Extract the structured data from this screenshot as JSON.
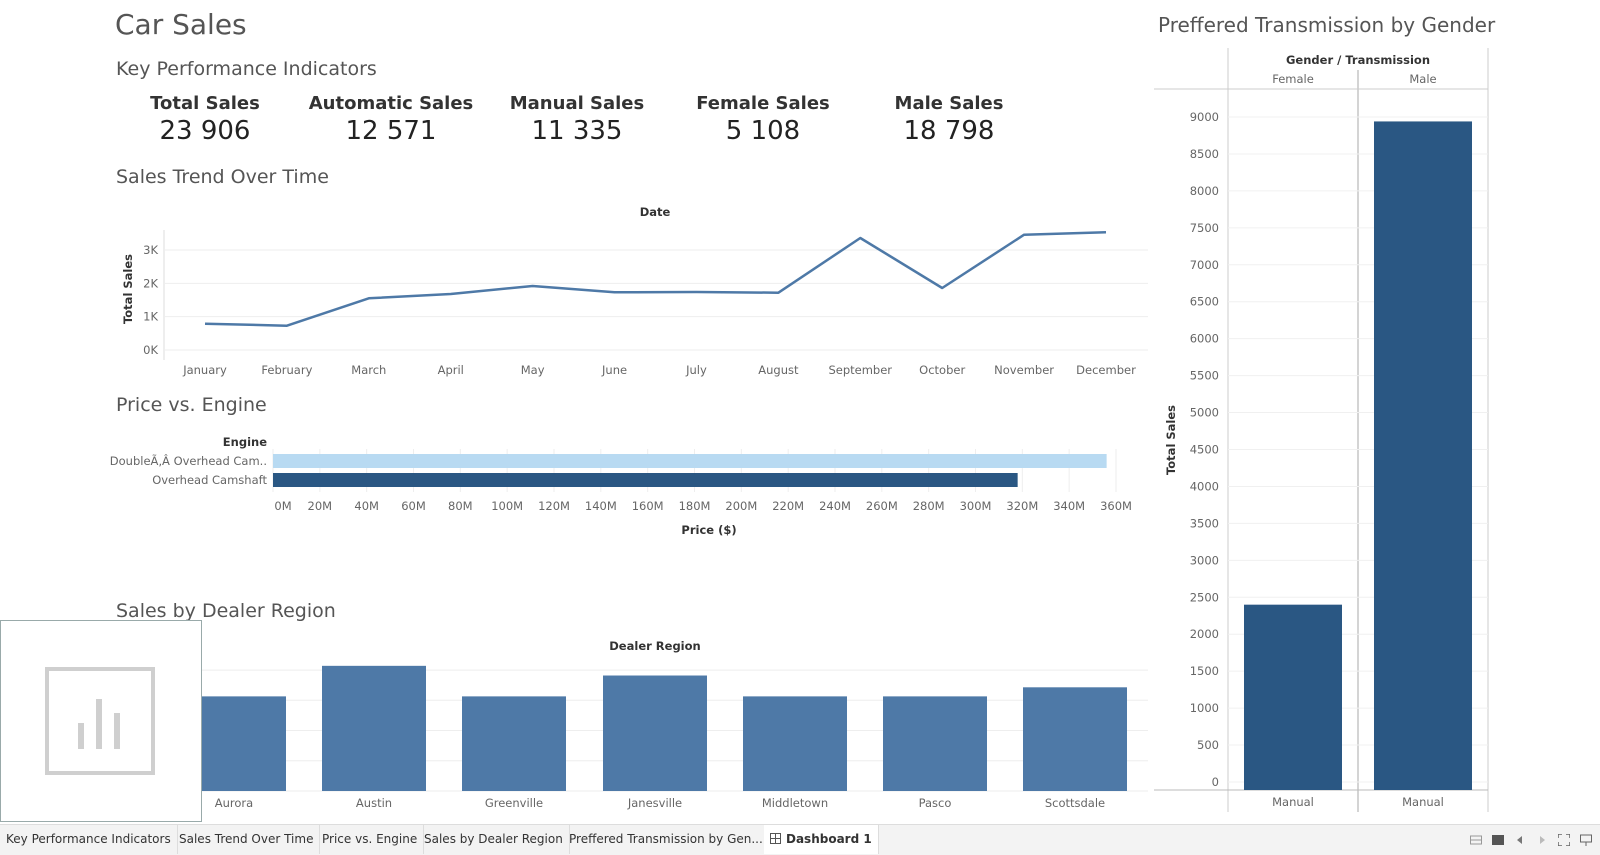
{
  "dashboard": {
    "title": "Car Sales",
    "kpi_section_title": "Key Performance Indicators",
    "kpis": [
      {
        "label": "Total Sales",
        "value": "23 906"
      },
      {
        "label": "Automatic Sales",
        "value": "12 571"
      },
      {
        "label": "Manual Sales",
        "value": "11 335"
      },
      {
        "label": "Female Sales",
        "value": "5 108"
      },
      {
        "label": "Male Sales",
        "value": "18 798"
      }
    ]
  },
  "chart_data": [
    {
      "id": "trend",
      "type": "line",
      "title": "Sales Trend Over Time",
      "header": "Date",
      "ylabel": "Total Sales",
      "x": [
        "January",
        "February",
        "March",
        "April",
        "May",
        "June",
        "July",
        "August",
        "September",
        "October",
        "November",
        "December"
      ],
      "values": [
        790,
        730,
        1550,
        1680,
        1920,
        1730,
        1740,
        1720,
        3360,
        1860,
        3460,
        3530
      ],
      "yticks": [
        "0K",
        "1K",
        "2K",
        "3K"
      ],
      "ylim": [
        0,
        3600
      ],
      "color": "#4e79a7"
    },
    {
      "id": "engine",
      "type": "bar",
      "orientation": "horizontal",
      "title": "Price vs. Engine",
      "header": "Engine",
      "xlabel": "Price ($)",
      "categories": [
        "DoubleÃ‚Â Overhead Cam..",
        "Overhead Camshaft"
      ],
      "values": [
        356,
        318
      ],
      "colors": [
        "#b8daf2",
        "#2a5783"
      ],
      "xticks": [
        "0M",
        "20M",
        "40M",
        "60M",
        "80M",
        "100M",
        "120M",
        "140M",
        "160M",
        "180M",
        "200M",
        "220M",
        "240M",
        "260M",
        "280M",
        "300M",
        "320M",
        "340M",
        "360M"
      ],
      "xlim": [
        0,
        360
      ]
    },
    {
      "id": "region",
      "type": "bar",
      "title": "Sales by Dealer Region",
      "header": "Dealer Region",
      "categories": [
        "Aurora",
        "Austin",
        "Greenville",
        "Janesville",
        "Middletown",
        "Pasco",
        "Scottsdale"
      ],
      "values": [
        3130,
        4140,
        3130,
        3820,
        3130,
        3130,
        3430
      ],
      "ylim": [
        0,
        4300
      ],
      "color": "#4e79a7"
    },
    {
      "id": "gender",
      "type": "bar",
      "title": "Preffered  Transmission by Gender",
      "header": "Gender / Transmission",
      "ylabel": "Total Sales",
      "groups": [
        "Female",
        "Male"
      ],
      "categories": [
        "Manual",
        "Manual"
      ],
      "values": [
        2400,
        8940
      ],
      "yticks": [
        "0",
        "500",
        "1000",
        "1500",
        "2000",
        "2500",
        "3000",
        "3500",
        "4000",
        "4500",
        "5000",
        "5500",
        "6000",
        "6500",
        "7000",
        "7500",
        "8000",
        "8500",
        "9000"
      ],
      "ylim": [
        0,
        9200
      ],
      "color": "#2a5783"
    }
  ],
  "tabs": [
    "Key Performance Indicators",
    "Sales Trend Over Time",
    "Price vs. Engine",
    "Sales by Dealer Region",
    "Preffered  Transmission by Gen...",
    "Dashboard 1"
  ],
  "active_tab": "Dashboard 1",
  "icons": {
    "placeholder": "bar-chart-placeholder-icon",
    "tab_dashboard": "dashboard-grid-icon"
  }
}
